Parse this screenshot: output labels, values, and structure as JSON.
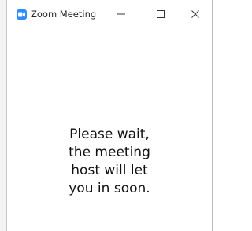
{
  "window": {
    "title": "Zoom Meeting",
    "app_icon": "zoom-camera-icon",
    "controls": {
      "minimize_icon": "minimize-icon",
      "maximize_icon": "maximize-icon",
      "close_icon": "close-icon"
    }
  },
  "waiting_room": {
    "message_lines": [
      "Please wait,",
      "the meeting",
      "host will let",
      "you in soon."
    ]
  },
  "colors": {
    "zoom_blue": "#2d8cff",
    "text": "#111111"
  }
}
